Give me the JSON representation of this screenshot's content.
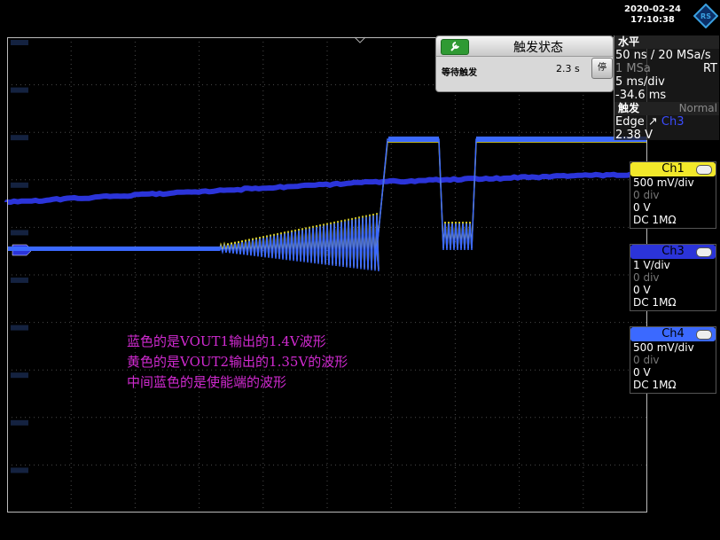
{
  "header": {
    "date": "2020-02-24",
    "time": "17:10:38"
  },
  "colors": {
    "ch1": "#f2e82a",
    "ch2": "#2b34d9",
    "ch4": "#3b69ff",
    "annotation": "#d02ad0"
  },
  "trigger_popup": {
    "title": "触发状态",
    "row_label": "等待触发",
    "row_value": "2.3 s",
    "stop_label": "停"
  },
  "horizontal": {
    "header": "水平",
    "rate": "50 ns / 20 MSa/s",
    "samples": "1 MSa",
    "mode": "RT",
    "scale": "5 ms/div",
    "position": "-34.6 ms"
  },
  "trigger": {
    "header": "触发",
    "mode": "Normal",
    "type": "Edge",
    "source": "Ch3",
    "level": "2.38 V"
  },
  "channels": [
    {
      "name": "Ch1",
      "scale": "500 mV/div",
      "offset": "0 div",
      "position": "0 V",
      "coupling": "DC 1MΩ"
    },
    {
      "name": "Ch3",
      "scale": "1 V/div",
      "offset": "0 div",
      "position": "0 V",
      "coupling": "DC 1MΩ"
    },
    {
      "name": "Ch4",
      "scale": "500 mV/div",
      "offset": "0 div",
      "position": "0 V",
      "coupling": "DC 1MΩ"
    }
  ],
  "annotations": [
    "蓝色的是VOUT1输出的1.4V波形",
    "黄色的是VOUT2输出的1.35V的波形",
    "中间蓝色的是使能端的波形"
  ]
}
